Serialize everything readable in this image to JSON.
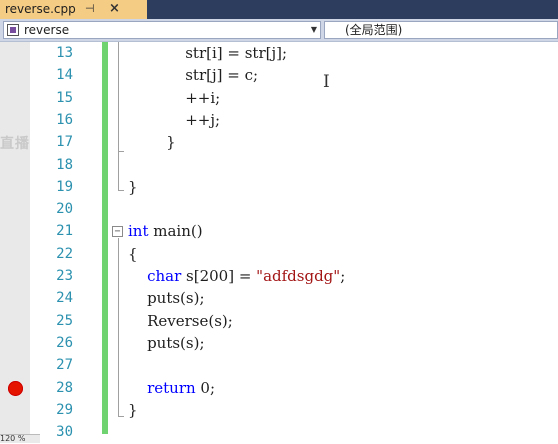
{
  "tab": {
    "filename": "reverse.cpp",
    "pin_glyph": "⊣",
    "close_glyph": "×"
  },
  "navbar": {
    "scope": "reverse",
    "namespace": "(全局范围)"
  },
  "editor": {
    "lines": [
      {
        "n": "13",
        "tokens": [
          {
            "t": "            str[i] = str[j];",
            "c": ""
          }
        ]
      },
      {
        "n": "14",
        "tokens": [
          {
            "t": "            str[j] = c;",
            "c": ""
          }
        ]
      },
      {
        "n": "15",
        "tokens": [
          {
            "t": "            ++i;",
            "c": ""
          }
        ]
      },
      {
        "n": "16",
        "tokens": [
          {
            "t": "            ++j;",
            "c": ""
          }
        ]
      },
      {
        "n": "17",
        "tokens": [
          {
            "t": "        }",
            "c": ""
          }
        ]
      },
      {
        "n": "18",
        "tokens": []
      },
      {
        "n": "19",
        "tokens": [
          {
            "t": "}",
            "c": ""
          }
        ]
      },
      {
        "n": "20",
        "tokens": []
      },
      {
        "n": "21",
        "tokens": [
          {
            "t": "int",
            "c": "kw"
          },
          {
            "t": " main()",
            "c": ""
          }
        ]
      },
      {
        "n": "22",
        "tokens": [
          {
            "t": "{",
            "c": ""
          }
        ]
      },
      {
        "n": "23",
        "tokens": [
          {
            "t": "    ",
            "c": ""
          },
          {
            "t": "char",
            "c": "kw"
          },
          {
            "t": " s[200] = ",
            "c": ""
          },
          {
            "t": "\"adfdsgdg\"",
            "c": "str"
          },
          {
            "t": ";",
            "c": ""
          }
        ]
      },
      {
        "n": "24",
        "tokens": [
          {
            "t": "    puts(s);",
            "c": ""
          }
        ]
      },
      {
        "n": "25",
        "tokens": [
          {
            "t": "    Reverse(s);",
            "c": ""
          }
        ]
      },
      {
        "n": "26",
        "tokens": [
          {
            "t": "    puts(s);",
            "c": ""
          }
        ]
      },
      {
        "n": "27",
        "tokens": []
      },
      {
        "n": "28",
        "tokens": [
          {
            "t": "    ",
            "c": ""
          },
          {
            "t": "return",
            "c": "kw"
          },
          {
            "t": " 0;",
            "c": ""
          }
        ]
      },
      {
        "n": "29",
        "tokens": [
          {
            "t": "}",
            "c": ""
          }
        ]
      },
      {
        "n": "30",
        "tokens": []
      }
    ],
    "breakpoint_line": "28",
    "fold_marker": "−",
    "colors": {
      "keyword": "#0000ff",
      "string": "#a31515",
      "line_number": "#2b91af",
      "change_bar": "#6fd36f",
      "breakpoint": "#e51400"
    }
  },
  "watermark": "直播",
  "status": {
    "zoom": "120 %"
  }
}
